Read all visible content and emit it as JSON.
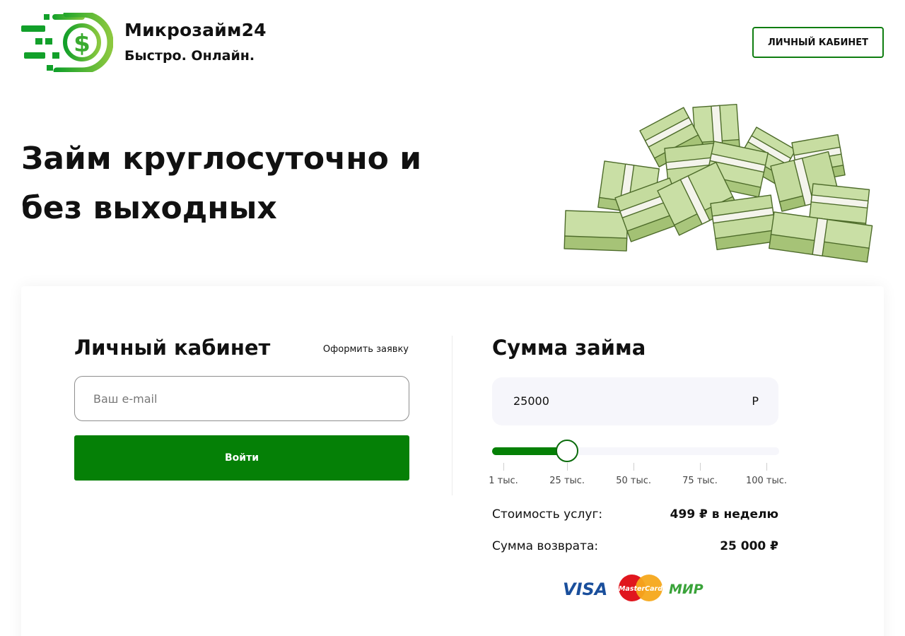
{
  "header": {
    "brand_name": "Микрозайм24",
    "tagline": "Быстро. Онлайн.",
    "logo_icon": "dollar-speed-logo",
    "cabinet_button": "ЛИЧНЫЙ КАБИНЕТ"
  },
  "hero": {
    "title_line1": "Займ круглосуточно и",
    "title_line2": "без выходных",
    "illustration_icon": "money-stacks-pile"
  },
  "login": {
    "title": "Личный кабинет",
    "apply_link": "Оформить заявку",
    "email_placeholder": "Ваш e-mail",
    "submit_label": "Войти"
  },
  "loan": {
    "title": "Сумма займа",
    "amount": "25000",
    "currency": "Р",
    "slider": {
      "min": 1000,
      "max": 100000,
      "value": 25000,
      "ticks": [
        {
          "value": 1000,
          "label": "1 тыс."
        },
        {
          "value": 25000,
          "label": "25 тыс."
        },
        {
          "value": 50000,
          "label": "50 тыс."
        },
        {
          "value": 75000,
          "label": "75 тыс."
        },
        {
          "value": 100000,
          "label": "100 тыс."
        }
      ]
    },
    "cost_label": "Стоимость услуг:",
    "cost_value": "499 ₽ в неделю",
    "return_label": "Сумма возврата:",
    "return_value": "25 000 ₽"
  },
  "payments": {
    "visa": "VISA",
    "mastercard": "MasterCard",
    "mir": "МИР"
  },
  "colors": {
    "accent": "#058006",
    "brand_gradient_start": "#12a02a",
    "brand_gradient_end": "#8bc83f",
    "input_bg": "#f6f6fb"
  }
}
